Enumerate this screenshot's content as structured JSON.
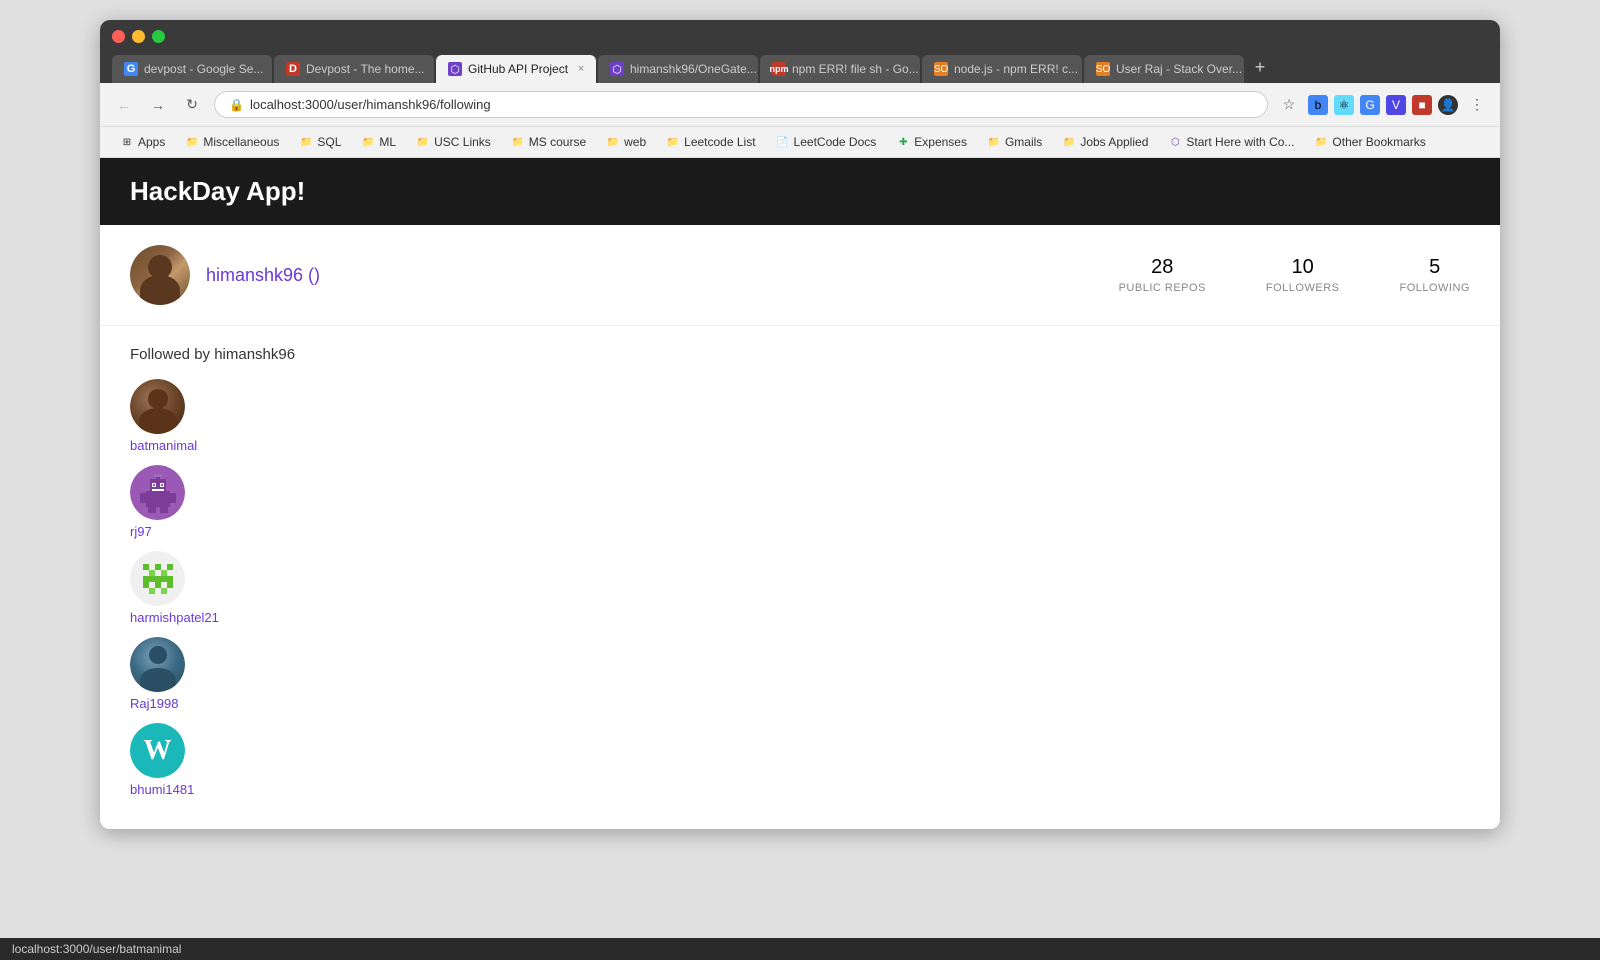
{
  "browser": {
    "tabs": [
      {
        "id": 1,
        "label": "devpost - Google Se...",
        "active": false,
        "favicon": "G"
      },
      {
        "id": 2,
        "label": "Devpost - The home...",
        "active": false,
        "favicon": "D"
      },
      {
        "id": 3,
        "label": "GitHub API Project",
        "active": true,
        "favicon": "⬡"
      },
      {
        "id": 4,
        "label": "himanshk96/OneGate...",
        "active": false,
        "favicon": "⬡"
      },
      {
        "id": 5,
        "label": "npm ERR! file sh - Go...",
        "active": false,
        "favicon": "N"
      },
      {
        "id": 6,
        "label": "node.js - npm ERR! c...",
        "active": false,
        "favicon": "S"
      },
      {
        "id": 7,
        "label": "User Raj - Stack Over...",
        "active": false,
        "favicon": "S"
      }
    ],
    "url": "localhost:3000/user/himanshk96/following",
    "bookmarks": [
      {
        "label": "Apps",
        "icon": "⊞"
      },
      {
        "label": "Miscellaneous",
        "icon": "📁"
      },
      {
        "label": "SQL",
        "icon": "📁"
      },
      {
        "label": "ML",
        "icon": "📁"
      },
      {
        "label": "USC Links",
        "icon": "📁"
      },
      {
        "label": "MS course",
        "icon": "📁"
      },
      {
        "label": "web",
        "icon": "📁"
      },
      {
        "label": "Leetcode List",
        "icon": "📁"
      },
      {
        "label": "LeetCode Docs",
        "icon": "📄"
      },
      {
        "label": "Expenses",
        "icon": "✚"
      },
      {
        "label": "Gmails",
        "icon": "📁"
      },
      {
        "label": "Jobs Applied",
        "icon": "📁"
      },
      {
        "label": "Start Here with Co...",
        "icon": "⬡"
      },
      {
        "label": "Other Bookmarks",
        "icon": "📁"
      }
    ]
  },
  "app": {
    "title": "HackDay App!"
  },
  "user": {
    "name": "himanshk96 ()",
    "stats": {
      "publicRepos": {
        "value": "28",
        "label": "PUBLIC REPOS"
      },
      "followers": {
        "value": "10",
        "label": "FOLLOWERS"
      },
      "following": {
        "value": "5",
        "label": "FOLLOWING"
      }
    }
  },
  "followingSection": {
    "title": "Followed by himanshk96",
    "users": [
      {
        "username": "batmanimal",
        "avatarClass": "av-batmanimal",
        "type": "photo"
      },
      {
        "username": "rj97",
        "avatarClass": "av-rj97",
        "type": "pixel-purple"
      },
      {
        "username": "harmishpatel21",
        "avatarClass": "av-harmishpatel21",
        "type": "pixel-green"
      },
      {
        "username": "Raj1998",
        "avatarClass": "av-raj1998",
        "type": "photo"
      },
      {
        "username": "bhumi1481",
        "avatarClass": "av-bhumi1481",
        "type": "letter"
      }
    ]
  },
  "statusBar": {
    "url": "localhost:3000/user/batmanimal"
  }
}
